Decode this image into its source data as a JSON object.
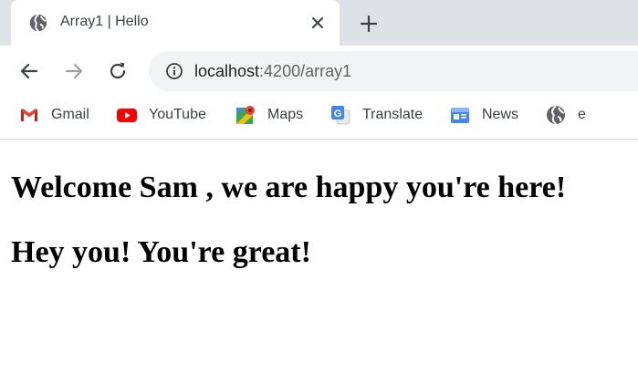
{
  "browser": {
    "tab": {
      "title": "Array1 | Hello",
      "favicon": "globe-icon",
      "close_icon": "close-icon"
    },
    "new_tab_icon": "plus-icon",
    "nav": {
      "back_icon": "arrow-left-icon",
      "forward_icon": "arrow-right-icon",
      "reload_icon": "reload-icon"
    },
    "address_bar": {
      "host": "localhost",
      "path": ":4200/array1",
      "info_icon": "info-icon"
    },
    "bookmarks": [
      {
        "label": "Gmail",
        "icon": "gmail-icon"
      },
      {
        "label": "YouTube",
        "icon": "youtube-icon"
      },
      {
        "label": "Maps",
        "icon": "maps-icon"
      },
      {
        "label": "Translate",
        "icon": "translate-icon"
      },
      {
        "label": "News",
        "icon": "news-icon"
      },
      {
        "label": "e",
        "icon": "globe-icon"
      }
    ]
  },
  "page": {
    "welcome": "Welcome Sam , we are happy you're here!",
    "compliment": "Hey you! You're great!"
  },
  "colors": {
    "tabstrip_bg": "#dee1e6",
    "omnibox_bg": "#f1f3f4",
    "icon_gray": "#5f6368",
    "youtube_red": "#ff0000"
  }
}
